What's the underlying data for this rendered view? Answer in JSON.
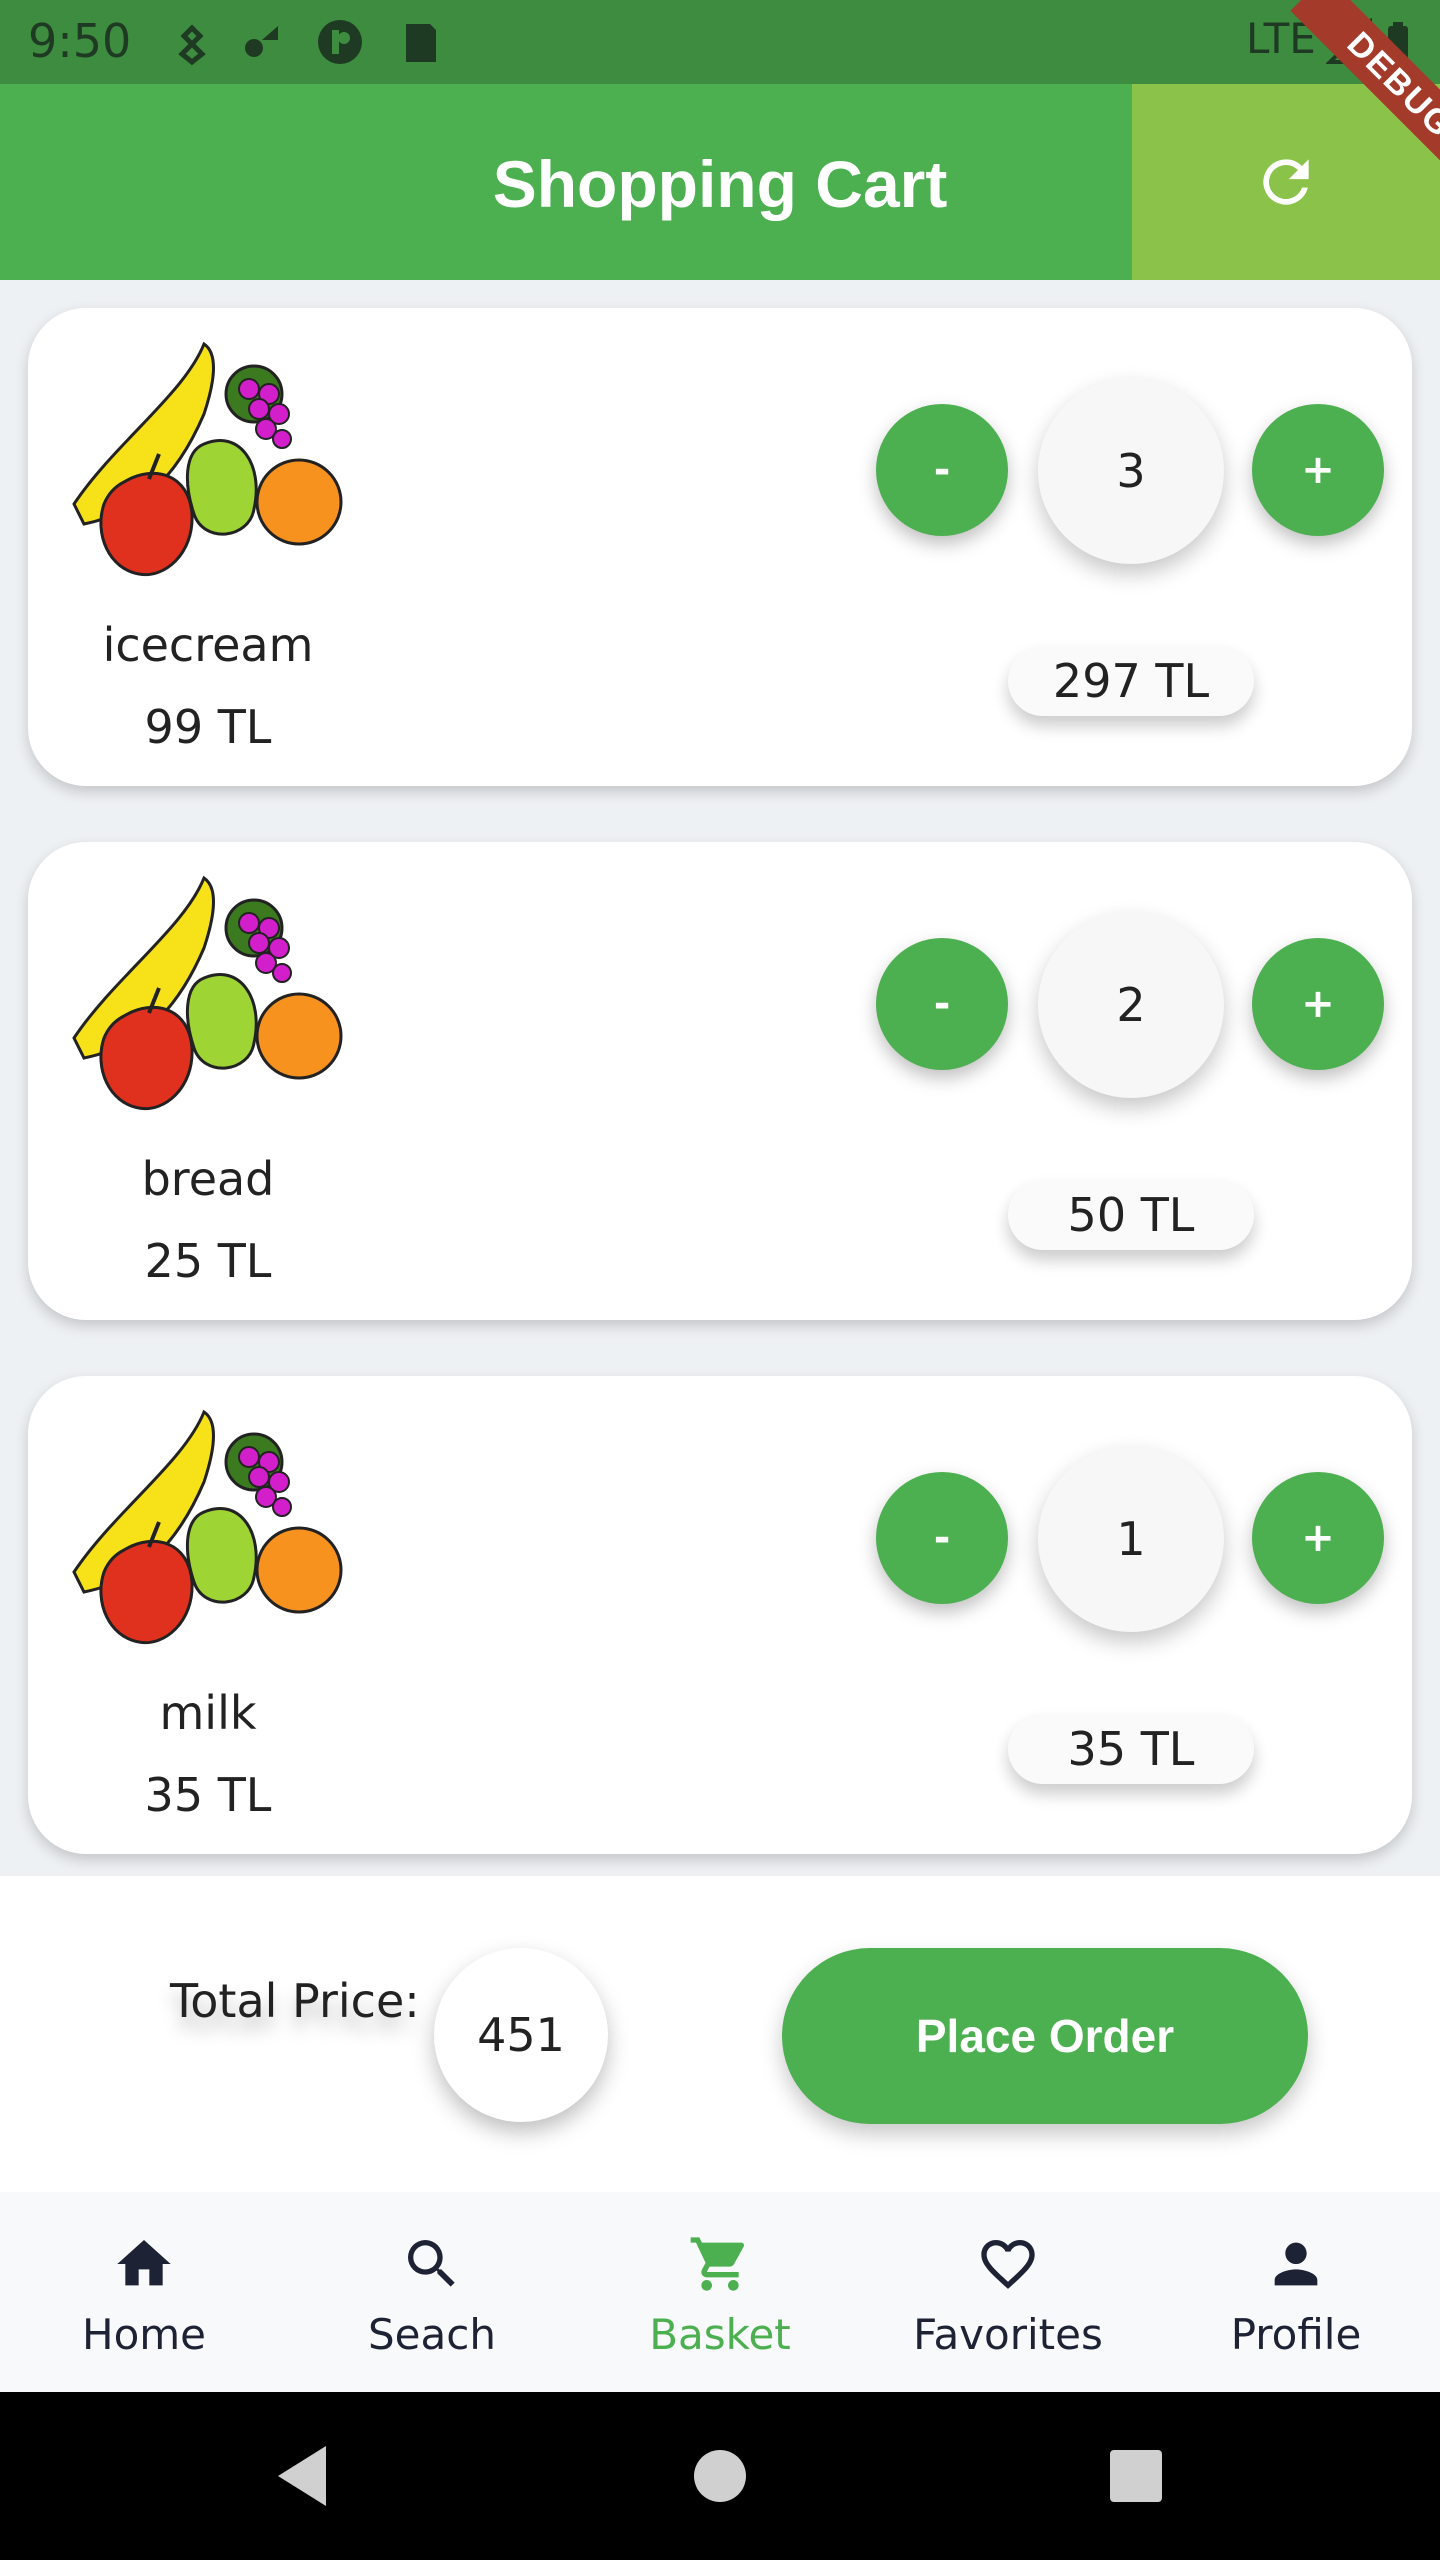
{
  "status_bar": {
    "time": "9:50",
    "network": "LTE"
  },
  "debug_banner": "DEBUG",
  "app_bar": {
    "title": "Shopping Cart",
    "refresh_icon": "refresh-icon"
  },
  "cart": {
    "items": [
      {
        "name": "icecream",
        "price": "99 TL",
        "quantity": "3",
        "subtotal": "297 TL",
        "minus": "-",
        "plus": "+"
      },
      {
        "name": "bread",
        "price": "25 TL",
        "quantity": "2",
        "subtotal": "50 TL",
        "minus": "-",
        "plus": "+"
      },
      {
        "name": "milk",
        "price": "35 TL",
        "quantity": "1",
        "subtotal": "35 TL",
        "minus": "-",
        "plus": "+"
      }
    ]
  },
  "footer": {
    "total_label": "Total Price:",
    "total_value": "451",
    "place_order": "Place Order"
  },
  "bottom_nav": {
    "items": [
      {
        "label": "Home",
        "icon": "home-icon"
      },
      {
        "label": "Seach",
        "icon": "search-icon"
      },
      {
        "label": "Basket",
        "icon": "cart-icon",
        "active": true
      },
      {
        "label": "Favorites",
        "icon": "heart-icon"
      },
      {
        "label": "Profile",
        "icon": "person-icon"
      }
    ]
  },
  "colors": {
    "primary": "#4caf50",
    "accent": "#8bc34a",
    "status_bar": "#3d8c40",
    "nav_text": "#1e2235"
  }
}
